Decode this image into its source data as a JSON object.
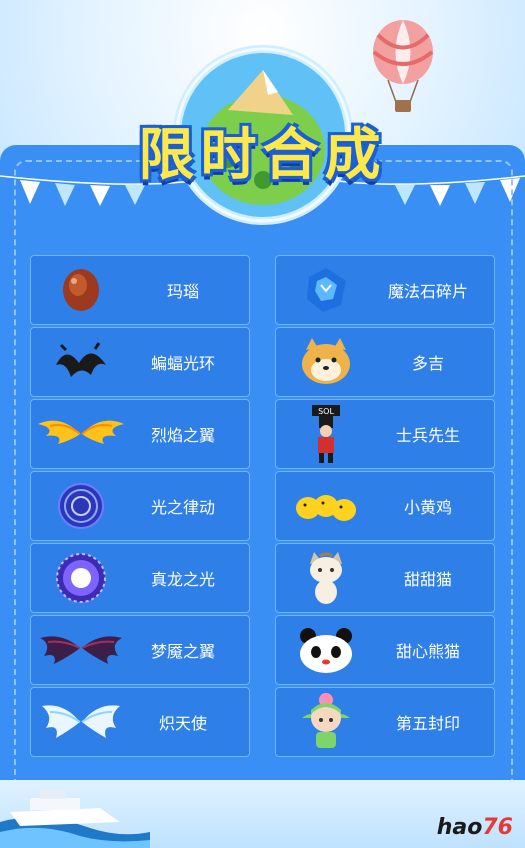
{
  "title": "限时合成",
  "left_items": [
    {
      "label": "玛瑙",
      "icon": "agate-icon"
    },
    {
      "label": "蝙蝠光环",
      "icon": "bat-halo-icon"
    },
    {
      "label": "烈焰之翼",
      "icon": "flame-wings-icon"
    },
    {
      "label": "光之律动",
      "icon": "light-rhythm-icon"
    },
    {
      "label": "真龙之光",
      "icon": "dragon-light-icon"
    },
    {
      "label": "梦魇之翼",
      "icon": "nightmare-wings-icon"
    },
    {
      "label": "炽天使",
      "icon": "seraph-wings-icon"
    }
  ],
  "right_items": [
    {
      "label": "魔法石碎片",
      "icon": "magic-stone-icon"
    },
    {
      "label": "多吉",
      "icon": "doge-icon"
    },
    {
      "label": "士兵先生",
      "icon": "soldier-icon",
      "sign": "SOL"
    },
    {
      "label": "小黄鸡",
      "icon": "yellow-chick-icon"
    },
    {
      "label": "甜甜猫",
      "icon": "sweet-cat-icon"
    },
    {
      "label": "甜心熊猫",
      "icon": "panda-icon"
    },
    {
      "label": "第五封印",
      "icon": "fifth-seal-icon"
    }
  ],
  "logo": {
    "main": "hao",
    "accent": "76"
  },
  "colors": {
    "board": "#3a8ff5",
    "cell": "#2f7fe8",
    "title": "#ffe94a"
  }
}
